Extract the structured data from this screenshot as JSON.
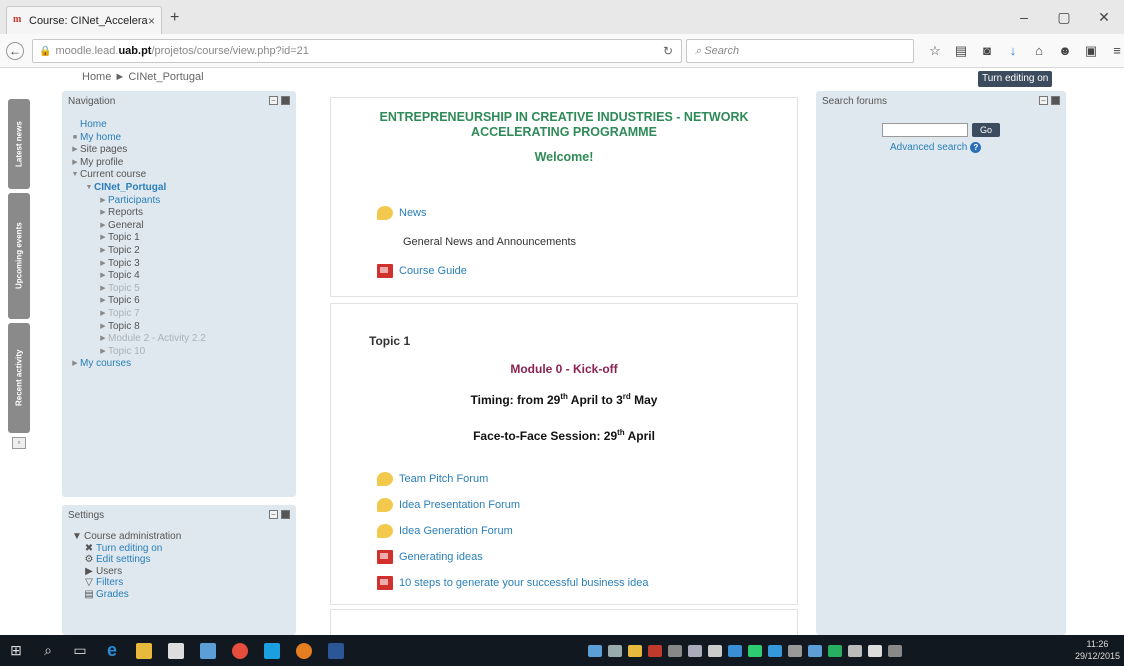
{
  "browser": {
    "tab_title": "Course: CINet_Acceleratin...",
    "tab_close": "×",
    "new_tab": "+",
    "url_host": "moodle.lead.",
    "url_strong": "uab.pt",
    "url_path": "/projetos/course/view.php?id=21",
    "search_placeholder": "Search",
    "window_controls": [
      "–",
      "▢",
      "✕"
    ]
  },
  "breadcrumb": {
    "home": "Home",
    "separator": "►",
    "current": "CINet_Portugal"
  },
  "turn_editing_button": "Turn editing on",
  "side_tabs": [
    "Latest news",
    "Upcoming events",
    "Recent activity"
  ],
  "navigation": {
    "title": "Navigation",
    "items": [
      {
        "label": "Home",
        "style": "link",
        "level": 1,
        "mark": ""
      },
      {
        "label": "My home",
        "style": "link",
        "level": 1,
        "mark": "■"
      },
      {
        "label": "Site pages",
        "style": "plain",
        "level": 1,
        "mark": "▶"
      },
      {
        "label": "My profile",
        "style": "plain",
        "level": 1,
        "mark": "▶"
      },
      {
        "label": "Current course",
        "style": "plain",
        "level": 1,
        "mark": "▼"
      },
      {
        "label": "CINet_Portugal",
        "style": "bold",
        "level": 2,
        "mark": "▼"
      },
      {
        "label": "Participants",
        "style": "link",
        "level": 3,
        "mark": "▶"
      },
      {
        "label": "Reports",
        "style": "plain",
        "level": 3,
        "mark": "▶"
      },
      {
        "label": "General",
        "style": "plain",
        "level": 3,
        "mark": "▶"
      },
      {
        "label": "Topic 1",
        "style": "plain",
        "level": 3,
        "mark": "▶"
      },
      {
        "label": "Topic 2",
        "style": "plain",
        "level": 3,
        "mark": "▶"
      },
      {
        "label": "Topic 3",
        "style": "plain",
        "level": 3,
        "mark": "▶"
      },
      {
        "label": "Topic 4",
        "style": "plain",
        "level": 3,
        "mark": "▶"
      },
      {
        "label": "Topic 5",
        "style": "dim",
        "level": 3,
        "mark": "▶"
      },
      {
        "label": "Topic 6",
        "style": "plain",
        "level": 3,
        "mark": "▶"
      },
      {
        "label": "Topic 7",
        "style": "dim",
        "level": 3,
        "mark": "▶"
      },
      {
        "label": "Topic 8",
        "style": "plain",
        "level": 3,
        "mark": "▶"
      },
      {
        "label": "Module 2 - Activity 2.2",
        "style": "dim",
        "level": 3,
        "mark": "▶"
      },
      {
        "label": "Topic 10",
        "style": "dim",
        "level": 3,
        "mark": "▶"
      },
      {
        "label": "My courses",
        "style": "link",
        "level": 1,
        "mark": "▶"
      }
    ]
  },
  "settings": {
    "title": "Settings",
    "items": [
      {
        "label": "Course administration",
        "style": "plain",
        "level": 1,
        "icon": "▼",
        "icon_name": "collapse-icon"
      },
      {
        "label": "Turn editing on",
        "style": "link",
        "level": 2,
        "icon": "✖",
        "icon_name": "edit-toggle-icon"
      },
      {
        "label": "Edit settings",
        "style": "link",
        "level": 2,
        "icon": "⚙",
        "icon_name": "gear-icon"
      },
      {
        "label": "Users",
        "style": "plain",
        "level": 2,
        "icon": "▶",
        "icon_name": "expand-icon"
      },
      {
        "label": "Filters",
        "style": "link",
        "level": 2,
        "icon": "▽",
        "icon_name": "filter-icon"
      },
      {
        "label": "Grades",
        "style": "link",
        "level": 2,
        "icon": "▤",
        "icon_name": "grades-icon"
      }
    ]
  },
  "search_forums": {
    "title": "Search forums",
    "go_label": "Go",
    "advanced_link": "Advanced search"
  },
  "course": {
    "title": "ENTREPRENEURSHIP IN CREATIVE INDUSTRIES - NETWORK ACCELERATING PROGRAMME",
    "welcome": "Welcome!",
    "news_link": "News",
    "news_description": "General News and Announcements",
    "guide_link": "Course Guide"
  },
  "topic1": {
    "heading": "Topic 1",
    "module_title": "Module 0 - Kick-off",
    "timing_prefix": "Timing: from 29",
    "timing_sup1": "th",
    "timing_mid": " April to 3",
    "timing_sup2": "rd",
    "timing_suffix": " May",
    "f2f_prefix": "Face-to-Face Session: 29",
    "f2f_sup": "th",
    "f2f_suffix": " April",
    "activities": [
      {
        "label": "Team Pitch Forum",
        "type": "forum"
      },
      {
        "label": "Idea Presentation Forum",
        "type": "forum"
      },
      {
        "label": "Idea Generation Forum",
        "type": "forum"
      },
      {
        "label": "Generating ideas",
        "type": "pdf"
      },
      {
        "label": "10 steps to generate your successful business idea",
        "type": "pdf"
      }
    ]
  },
  "taskbar": {
    "clock_time": "11:26",
    "clock_date": "29/12/2015"
  }
}
